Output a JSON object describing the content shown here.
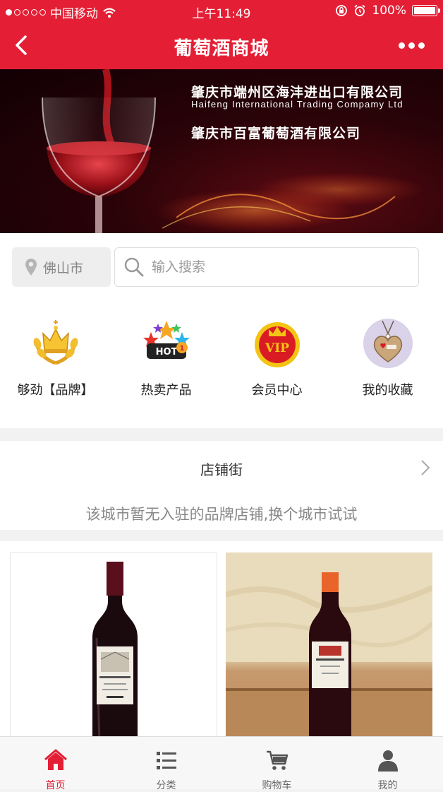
{
  "status_bar": {
    "carrier": "中国移动",
    "time": "上午11:49",
    "battery": "100%"
  },
  "header": {
    "title": "葡萄酒商城"
  },
  "banner": {
    "line1": "肇庆市端州区海沣进出口有限公司",
    "line2": "Haifeng International Trading Compamy Ltd",
    "line3": "肇庆市百富葡萄酒有限公司"
  },
  "search": {
    "city": "佛山市",
    "placeholder": "输入搜索"
  },
  "categories": [
    {
      "label": "够劲【品牌】",
      "icon": "crown-laurel-icon"
    },
    {
      "label": "热卖产品",
      "icon": "hot-sale-icon"
    },
    {
      "label": "会员中心",
      "icon": "vip-crown-icon"
    },
    {
      "label": "我的收藏",
      "icon": "heart-tag-icon"
    }
  ],
  "shop_street": {
    "title": "店铺街",
    "empty_message": "该城市暂无入驻的品牌店铺,换个城市试试"
  },
  "products": [
    {
      "image": "red-wine-bottle-white-background"
    },
    {
      "image": "red-wine-bottle-orange-cap-wooden-table"
    }
  ],
  "tabbar": [
    {
      "label": "首页",
      "icon": "home-icon",
      "active": true
    },
    {
      "label": "分类",
      "icon": "list-icon",
      "active": false
    },
    {
      "label": "购物车",
      "icon": "cart-icon",
      "active": false
    },
    {
      "label": "我的",
      "icon": "user-icon",
      "active": false
    }
  ],
  "colors": {
    "brand_red": "#e41f35",
    "text_muted": "#888888"
  }
}
